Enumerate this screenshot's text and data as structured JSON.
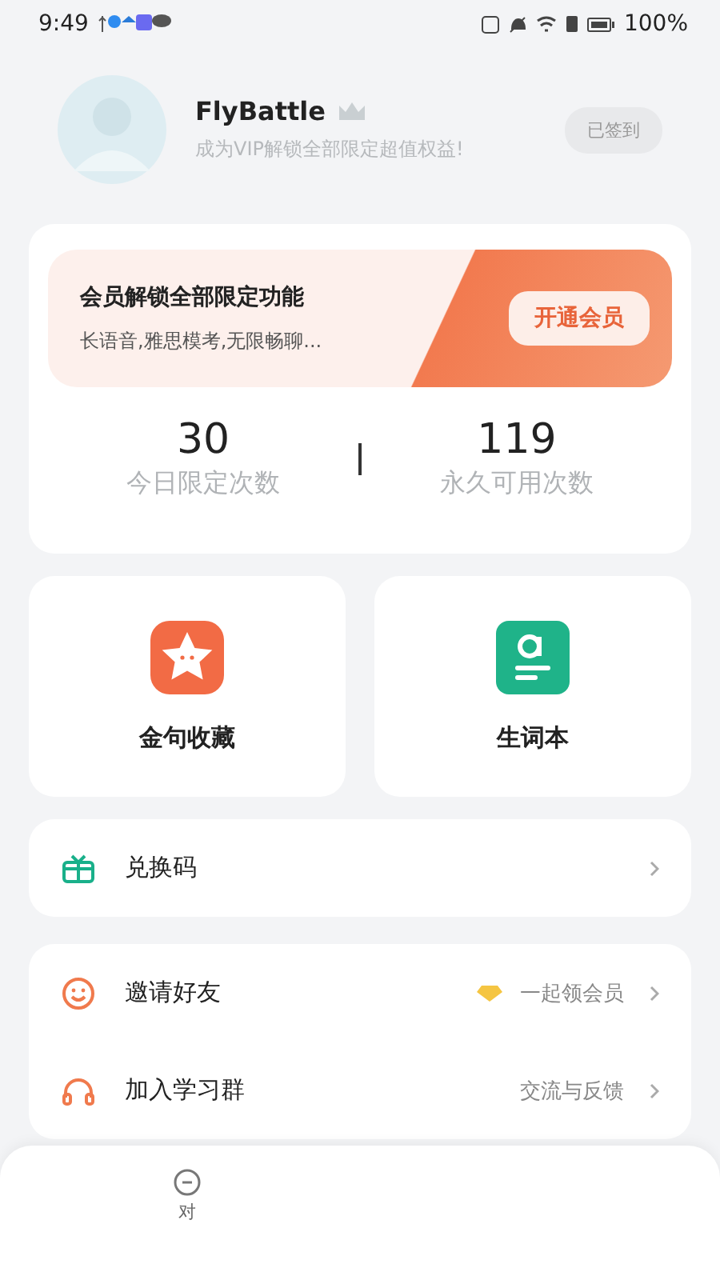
{
  "status_bar": {
    "time": "9:49",
    "battery": "100%"
  },
  "profile": {
    "name": "FlyBattle",
    "subtitle": "成为VIP解锁全部限定超值权益!",
    "checkin": "已签到"
  },
  "vip_banner": {
    "title": "会员解锁全部限定功能",
    "subtitle": "长语音,雅思模考,无限畅聊...",
    "button": "开通会员"
  },
  "stats": [
    {
      "value": "30",
      "label": "今日限定次数"
    },
    {
      "value": "119",
      "label": "永久可用次数"
    }
  ],
  "tiles": [
    {
      "kind": "star",
      "label": "金句收藏"
    },
    {
      "kind": "vocab",
      "label": "生词本"
    }
  ],
  "menu_groups": [
    [
      {
        "kind": "gift",
        "label": "兑换码"
      }
    ],
    [
      {
        "kind": "smile",
        "label": "邀请好友",
        "note": "一起领会员",
        "note_icon": true
      },
      {
        "kind": "headset",
        "label": "加入学习群",
        "note": "交流与反馈"
      }
    ]
  ],
  "bottom_nav": [
    {
      "label": "对"
    }
  ]
}
